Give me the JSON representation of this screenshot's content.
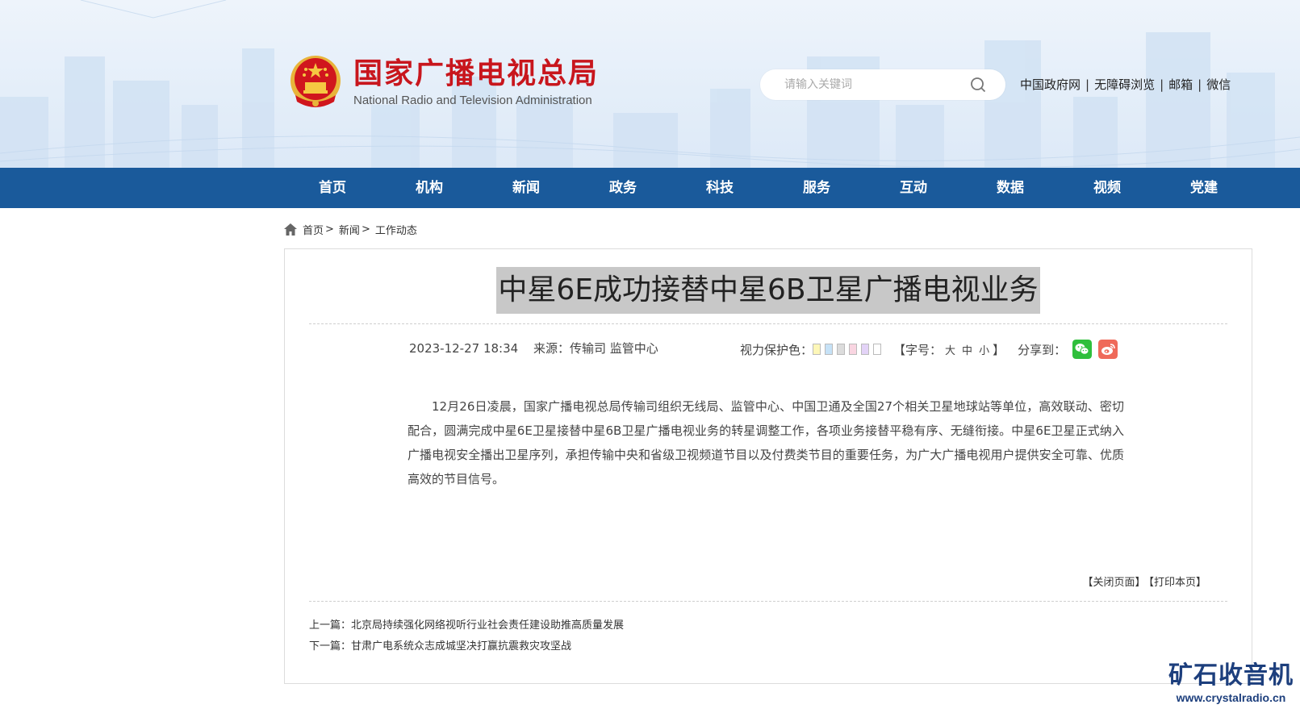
{
  "header": {
    "site_name_cn": "国家广播电视总局",
    "site_name_en": "National Radio and Television Administration",
    "search_placeholder": "请输入关键词",
    "top_links": [
      "中国政府网",
      "无障碍浏览",
      "邮箱",
      "微信"
    ],
    "brand_color": "#c8161d"
  },
  "nav": {
    "items": [
      "首页",
      "机构",
      "新闻",
      "政务",
      "科技",
      "服务",
      "互动",
      "数据",
      "视频",
      "党建"
    ],
    "bg_color": "#1a5a9b"
  },
  "breadcrumb": {
    "items": [
      "首页",
      "新闻",
      "工作动态"
    ]
  },
  "article": {
    "title": "中星6E成功接替中星6B卫星广播电视业务",
    "datetime": "2023-12-27 18:34",
    "source_label": "来源：",
    "source": "传输司 监管中心",
    "eye_color_label": "视力保护色：",
    "eye_colors": [
      "#fdf7b8",
      "#c6e2f7",
      "#dcdcdc",
      "#f9d5e1",
      "#e3d3f7",
      "#ffffff"
    ],
    "font_size_prefix": "【字号：",
    "font_sizes": [
      "大",
      "中",
      "小"
    ],
    "font_size_suffix": "】",
    "share_label": "分享到：",
    "share_icons": [
      "wechat-icon",
      "weibo-icon"
    ],
    "body": "12月26日凌晨，国家广播电视总局传输司组织无线局、监管中心、中国卫通及全国27个相关卫星地球站等单位，高效联动、密切配合，圆满完成中星6E卫星接替中星6B卫星广播电视业务的转星调整工作，各项业务接替平稳有序、无缝衔接。中星6E卫星正式纳入广播电视安全播出卫星序列，承担传输中央和省级卫视频道节目以及付费类节目的重要任务，为广大广播电视用户提供安全可靠、优质高效的节目信号。",
    "close_page": "【关闭页面】",
    "print_page": "【打印本页】",
    "prev_label": "上一篇：",
    "prev_title": "北京局持续强化网络视听行业社会责任建设助推高质量发展",
    "next_label": "下一篇：",
    "next_title": "甘肃广电系统众志成城坚决打赢抗震救灾攻坚战"
  },
  "watermark": {
    "cn": "矿石收音机",
    "url": "www.crystalradio.cn"
  }
}
